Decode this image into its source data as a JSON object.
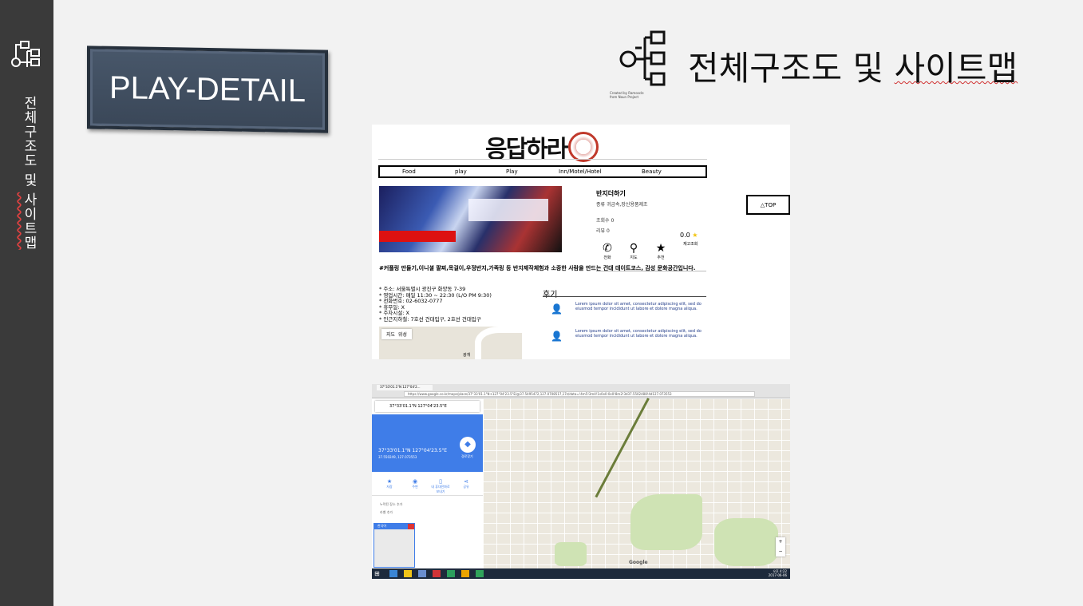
{
  "slide": {
    "plaque_title": "PLAY-DETAIL",
    "section_title_a": "전체구조도 및 ",
    "section_title_b": "사이트맵",
    "credit_line1": "Created by Ramoscle",
    "credit_line2": "from Noun Project",
    "side_title_a": "전체구조도 및 ",
    "side_title_b": "사이트맵"
  },
  "site": {
    "brand": "응답하라",
    "nav": [
      "Food",
      "play",
      "Play",
      "Inn/Motel/Hotel",
      "Beauty"
    ],
    "place_name": "반지더하기",
    "kind": "종류   귀금속,장신용품제조",
    "views": "조회수   0",
    "reviews_count": "리뷰   0",
    "rating": "0.0",
    "rating_icon": "star-icon",
    "stock_label": "재고조회",
    "actions": [
      {
        "label": "전화",
        "icon": "phone-icon"
      },
      {
        "label": "지도",
        "icon": "map-pin-icon"
      },
      {
        "label": "추천",
        "icon": "star-icon"
      }
    ],
    "top_button": "△TOP",
    "description": "#커플링 만들기,이니셜 팔찌,목걸이,우정반지,가족링 등 반지제작체험과 소중한 사람을 만드는 건대 데이트코스, 감성 문화공간입니다.",
    "address_lines": [
      "* 주소: 서울특별시 광진구 화양동 7-39",
      "* 영업시간: 매일 11:30 ~ 22:30 (L/O PM 9:30)",
      "* 전화번호: 02-6032-0777",
      "* 휴무일: X",
      "* 주차시설: X",
      "* 인근지하철: 7호선 건대입구, 2호선 건대입구"
    ],
    "review_heading": "후기",
    "review_text": "Lorem ipsum dolor sit amet, consectetur adipiscing elit, sed do eiusmod tempor incididunt ut labore et dolore magna aliqua.",
    "map_tab_map": "지도",
    "map_tab_sat": "위성",
    "map_station": "광개"
  },
  "gmap": {
    "tab_title": "37°33'01.1\"N 127°04'2...",
    "url": "https://www.google.co.kr/maps/place/37°33'01.1\"N+127°04'23.5\"E/@37.5495472,127.0708517,17z/data=!4m5!3m4!1s0x0:0x0!8m2!3d37.5502488!4d127.073553",
    "search_value": "37°33'01.1\"N 127°04'23.5\"E",
    "coord_title": "37°33'01.1\"N 127°04'23.5\"E",
    "coord_sub": "37.550249, 127.073553",
    "directions_label": "경로찾기",
    "actions": [
      "저장",
      "주변",
      "내 휴대전화로 보내기",
      "공유"
    ],
    "item1": "누락된 장소 추가",
    "item2": "라벨 추가",
    "dialog_title": "한국어",
    "map_logo": "Google",
    "clock_time": "오후 4:22",
    "clock_date": "2017-06-06"
  }
}
